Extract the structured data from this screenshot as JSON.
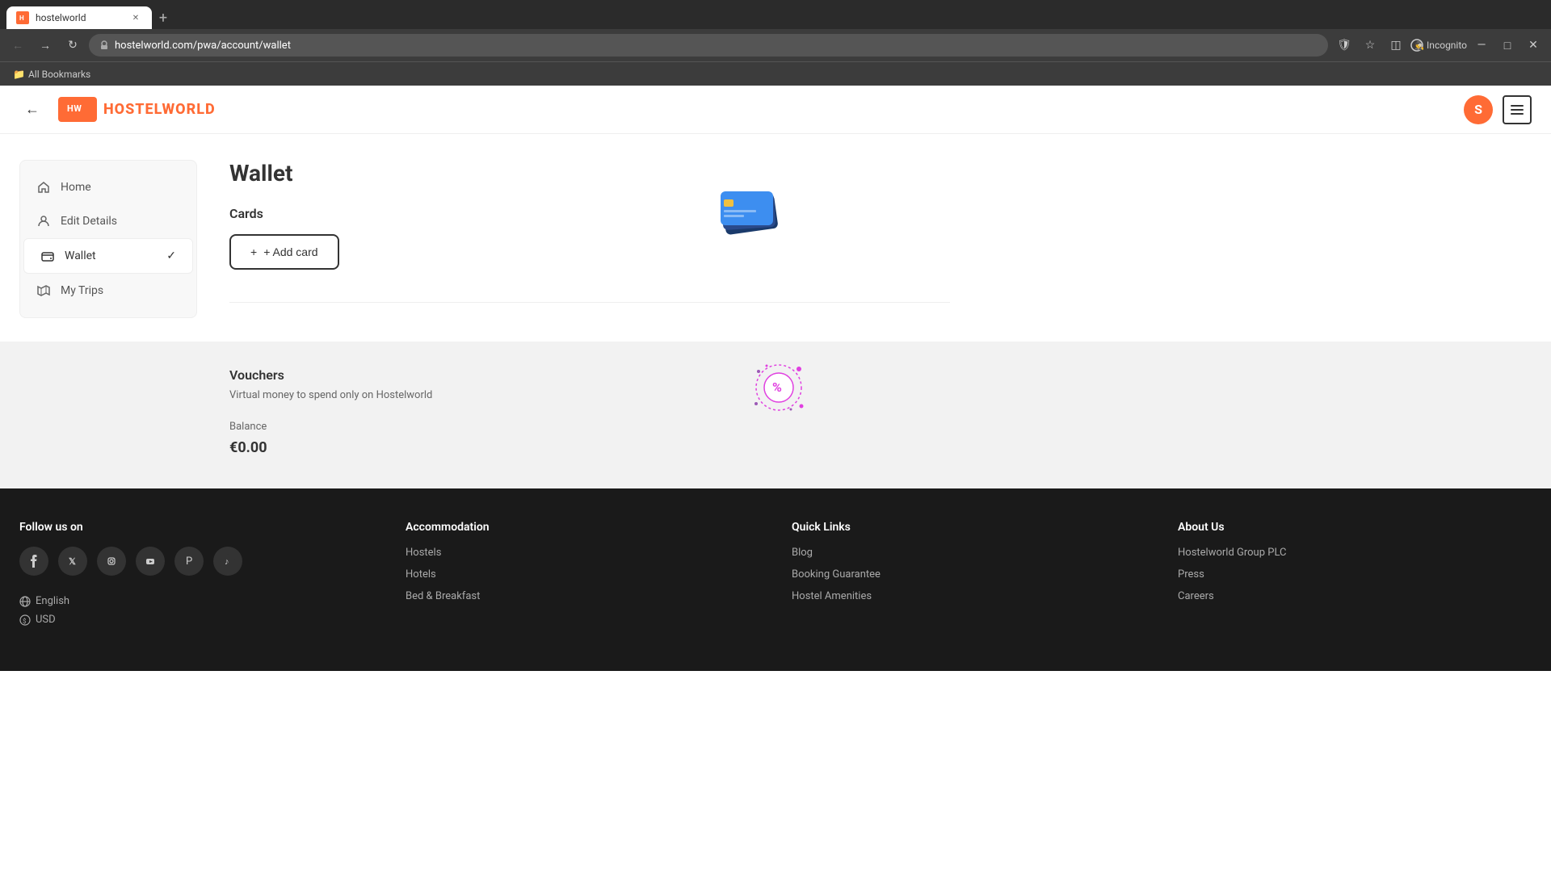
{
  "browser": {
    "tab_label": "hostelworld",
    "tab_favicon": "HW",
    "url": "hostelworld.com/pwa/account/wallet",
    "incognito_label": "Incognito",
    "bookmarks_label": "All Bookmarks"
  },
  "header": {
    "logo_box": "HW",
    "logo_text": "HOSTELWORLD",
    "user_initial": "S"
  },
  "sidebar": {
    "items": [
      {
        "label": "Home",
        "icon": "home"
      },
      {
        "label": "Edit Details",
        "icon": "user"
      },
      {
        "label": "Wallet",
        "icon": "wallet",
        "active": true
      },
      {
        "label": "My Trips",
        "icon": "map"
      }
    ]
  },
  "wallet": {
    "title": "Wallet",
    "cards_title": "Cards",
    "add_card_label": "+ Add card",
    "vouchers_title": "Vouchers",
    "vouchers_desc": "Virtual money to spend only on Hostelworld",
    "balance_label": "Balance",
    "balance_amount": "€0.00"
  },
  "footer": {
    "follow_us": "Follow us on",
    "social_icons": [
      "facebook",
      "twitter-x",
      "instagram",
      "youtube",
      "pinterest",
      "tiktok"
    ],
    "accommodation_title": "Accommodation",
    "accommodation_links": [
      "Hostels",
      "Hotels",
      "Bed & Breakfast"
    ],
    "quick_links_title": "Quick Links",
    "quick_links": [
      "Blog",
      "Booking Guarantee",
      "Hostel Amenities"
    ],
    "about_us_title": "About Us",
    "about_us_links": [
      "Hostelworld Group PLC",
      "Press",
      "Careers"
    ],
    "language_label": "English",
    "currency_label": "USD"
  }
}
